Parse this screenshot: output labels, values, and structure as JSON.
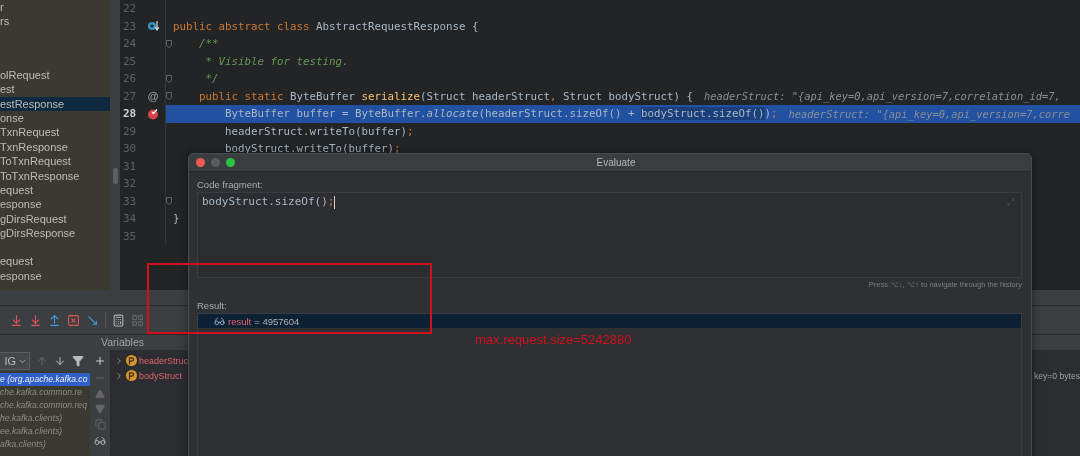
{
  "project_tree": {
    "groups": [
      {
        "items": [
          {
            "label": "r",
            "selected": false
          },
          {
            "label": "rs",
            "selected": false
          }
        ]
      },
      {
        "items": [
          {
            "label": "olRequest",
            "selected": false
          },
          {
            "label": "est",
            "selected": false
          },
          {
            "label": "estResponse",
            "selected": true
          },
          {
            "label": "onse",
            "selected": false
          },
          {
            "label": "TxnRequest",
            "selected": false
          },
          {
            "label": "TxnResponse",
            "selected": false
          },
          {
            "label": "ToTxnRequest",
            "selected": false
          },
          {
            "label": "ToTxnResponse",
            "selected": false
          },
          {
            "label": "equest",
            "selected": false
          },
          {
            "label": "esponse",
            "selected": false
          },
          {
            "label": "gDirsRequest",
            "selected": false
          },
          {
            "label": "gDirsResponse",
            "selected": false
          }
        ]
      },
      {
        "items": [
          {
            "label": "equest",
            "selected": false
          },
          {
            "label": "esponse",
            "selected": false
          }
        ]
      }
    ]
  },
  "editor": {
    "lines": [
      {
        "number": "22",
        "current": false,
        "fold": false
      },
      {
        "number": "23",
        "current": false,
        "fold": false,
        "gutter": {
          "kind": "implemented"
        },
        "tokens": [
          {
            "kind": "keyword",
            "text": "public abstract class "
          },
          {
            "kind": "plain",
            "text": "AbstractRequestResponse {"
          }
        ]
      },
      {
        "number": "24",
        "current": false,
        "fold": true,
        "tokens": [
          {
            "kind": "comment",
            "text": "    /**"
          }
        ]
      },
      {
        "number": "25",
        "current": false,
        "fold": false,
        "tokens": [
          {
            "kind": "comment",
            "text": "     * Visible for testing."
          }
        ]
      },
      {
        "number": "26",
        "current": false,
        "fold": true,
        "tokens": [
          {
            "kind": "comment",
            "text": "     */"
          }
        ]
      },
      {
        "number": "27",
        "current": false,
        "fold": true,
        "gutter_text": "@",
        "tokens": [
          {
            "kind": "keyword",
            "text": "    public static "
          },
          {
            "kind": "plain",
            "text": "ByteBuffer "
          },
          {
            "kind": "method",
            "text": "serialize"
          },
          {
            "kind": "plain",
            "text": "(Struct headerStruct"
          },
          {
            "kind": "punct",
            "text": ","
          },
          {
            "kind": "plain",
            "text": " Struct bodyStruct) {"
          }
        ],
        "hint": "headerStruct: \"{api_key=0,api_version=7,correlation_id=7,"
      },
      {
        "number": "28",
        "current": true,
        "fold": false,
        "gutter": {
          "kind": "breakpoint"
        },
        "tokens": [
          {
            "kind": "plain",
            "text": "        ByteBuffer buffer = ByteBuffer."
          },
          {
            "kind": "call",
            "text": "allocate"
          },
          {
            "kind": "plain",
            "text": "(headerStruct.sizeOf() + "
          },
          {
            "kind": "match",
            "text": "bodyStruct.sizeOf()"
          },
          {
            "kind": "plain",
            "text": ")"
          },
          {
            "kind": "punct",
            "text": ";"
          }
        ],
        "hint": "headerStruct: \"{api_key=0,api_version=7,corre"
      },
      {
        "number": "29",
        "current": false,
        "fold": false,
        "tokens": [
          {
            "kind": "plain",
            "text": "        headerStruct.writeTo(buffer)"
          },
          {
            "kind": "punct",
            "text": ";"
          }
        ]
      },
      {
        "number": "30",
        "current": false,
        "fold": false,
        "tokens": [
          {
            "kind": "plain",
            "text": "        bodyStruct.writeTo(buffer)"
          },
          {
            "kind": "punct",
            "text": ";"
          }
        ]
      },
      {
        "number": "31",
        "current": false,
        "fold": false
      },
      {
        "number": "32",
        "current": false,
        "fold": false
      },
      {
        "number": "33",
        "current": false,
        "fold": true
      },
      {
        "number": "34",
        "current": false,
        "fold": false,
        "tokens": [
          {
            "kind": "plain",
            "text": "}"
          }
        ]
      },
      {
        "number": "35",
        "current": false,
        "fold": false
      }
    ]
  },
  "debug": {
    "frames": {
      "dropdown": "IG",
      "items": [
        {
          "label": "e (org.apache.kafka.co",
          "selected": true
        },
        {
          "label": "che.kafka.common.re",
          "selected": false
        },
        {
          "label": "che.kafka.common.req",
          "selected": false
        },
        {
          "label": "he.kafka.clients)",
          "selected": false
        },
        {
          "label": "ee.kafka.clients)",
          "selected": false
        },
        {
          "label": "afka.clients)",
          "selected": false
        }
      ]
    },
    "variables": {
      "title": "Variables",
      "items": [
        {
          "name": "headerStruc",
          "expanded": false
        },
        {
          "name": "bodyStruct",
          "expanded": false,
          "value": "key=0 bytes"
        }
      ]
    }
  },
  "evaluate_dialog": {
    "title": "Evaluate",
    "code_label": "Code fragment:",
    "code_tokens": [
      {
        "kind": "plain",
        "text": "bodyStruct.sizeOf()"
      },
      {
        "kind": "punct",
        "text": ";"
      }
    ],
    "history_hint": "Press ⌥↓, ⌥↑ to navigate through the history",
    "result_label": "Result:",
    "result": {
      "name": "result",
      "value": "= 4957604",
      "selected": true
    }
  },
  "annotation": {
    "text": "max.request.size=5242880"
  }
}
